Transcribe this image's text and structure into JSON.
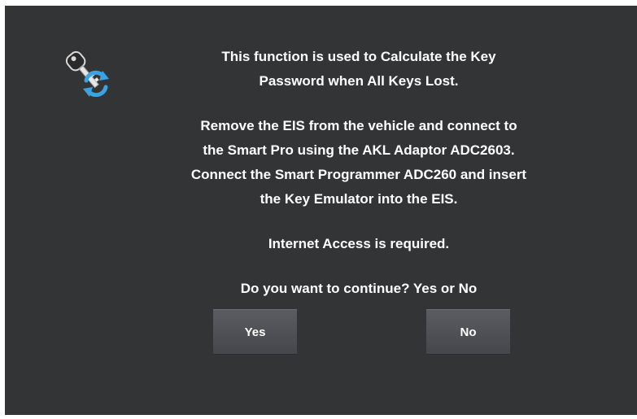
{
  "dialog": {
    "icon": "key-refresh-icon",
    "message_lines": [
      "This function is used to Calculate the Key",
      "Password when All Keys Lost.",
      "",
      "Remove the EIS from the vehicle and connect to",
      "the Smart Pro using the AKL Adaptor ADC2603.",
      "Connect the Smart Programmer ADC260 and insert",
      "the Key Emulator into the EIS.",
      "",
      "Internet Access is required.",
      "",
      "Do you want to continue? Yes or No"
    ],
    "yes_label": "Yes",
    "no_label": "No"
  },
  "colors": {
    "background": "#333435",
    "button": "#4e5055",
    "text": "#ffffff",
    "icon_accent": "#3aa3e3"
  }
}
